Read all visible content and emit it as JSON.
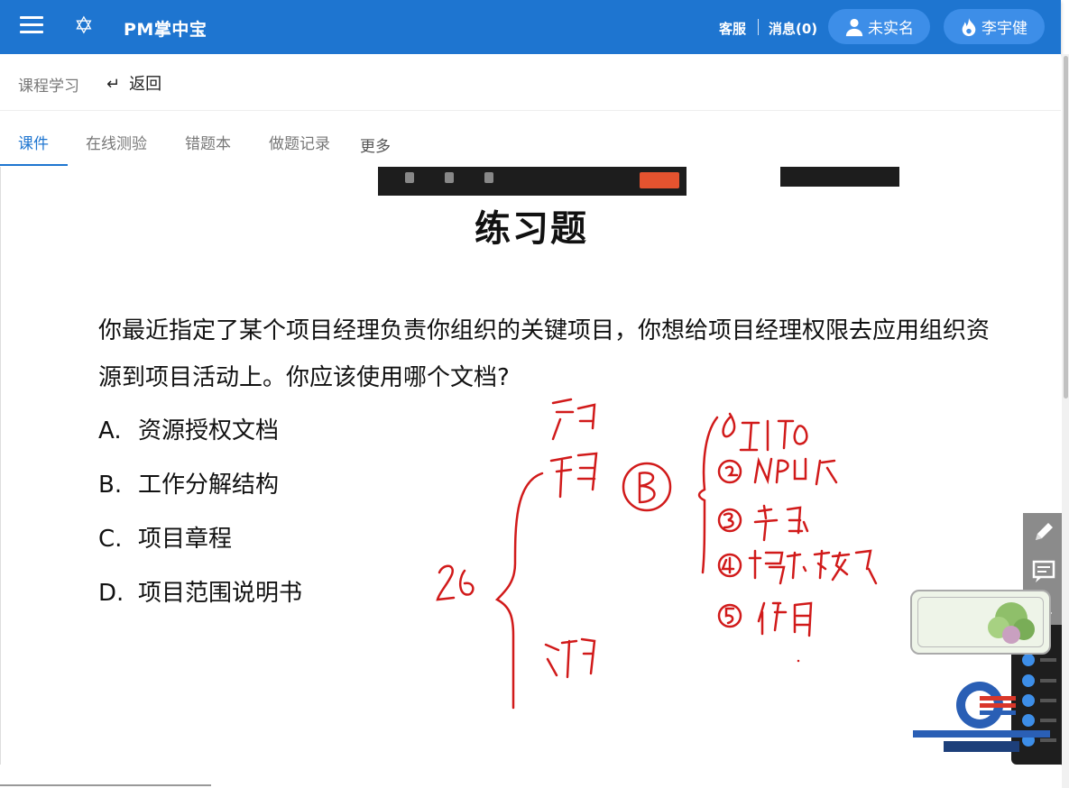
{
  "header": {
    "app_title": "PM掌中宝",
    "service_label": "客服",
    "messages_label": "消息(0)",
    "verify_label": "未实名",
    "user_name": "李宇健"
  },
  "subnav": {
    "breadcrumb": "课程学习",
    "back_label": "返回"
  },
  "tabs": [
    {
      "label": "课件",
      "active": true
    },
    {
      "label": "在线测验"
    },
    {
      "label": "错题本"
    },
    {
      "label": "做题记录"
    },
    {
      "label": "更多"
    }
  ],
  "slide": {
    "title": "练习题",
    "question": "你最近指定了某个项目经理负责你组织的关键项目，你想给项目经理权限去应用组织资源到项目活动上。你应该使用哪个文档?",
    "options": [
      {
        "letter": "A.",
        "text": "资源授权文档"
      },
      {
        "letter": "B.",
        "text": "工作分解结构"
      },
      {
        "letter": "C.",
        "text": "项目章程"
      },
      {
        "letter": "D.",
        "text": "项目范围说明书"
      }
    ]
  },
  "colors": {
    "header_bg": "#1e75d0",
    "pill_bg": "#3d8ee8",
    "accent": "#1e75d0",
    "ink": "#d11a1a"
  }
}
